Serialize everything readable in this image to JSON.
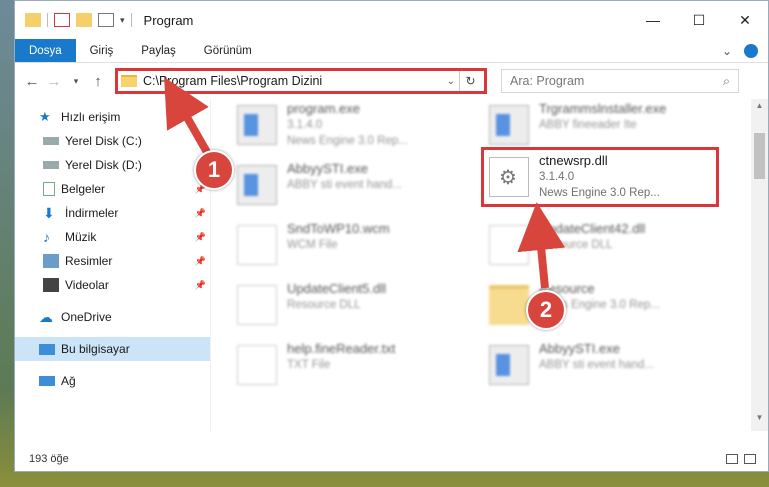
{
  "window": {
    "title": "Program",
    "controls": [
      "—",
      "☐",
      "✕"
    ]
  },
  "ribbon": {
    "tabs": [
      "Dosya",
      "Giriş",
      "Paylaş",
      "Görünüm"
    ]
  },
  "nav": {
    "address_path": "C:\\Program Files\\Program Dizini",
    "search_placeholder": "Ara: Program"
  },
  "sidebar": {
    "items": [
      {
        "label": "Hızlı erişim"
      },
      {
        "label": "Yerel Disk (C:)"
      },
      {
        "label": "Yerel Disk (D:)"
      },
      {
        "label": "Belgeler"
      },
      {
        "label": "İndirmeler"
      },
      {
        "label": "Müzik"
      },
      {
        "label": "Resimler"
      },
      {
        "label": "Videolar"
      },
      {
        "label": "OneDrive"
      },
      {
        "label": "Bu bilgisayar"
      },
      {
        "label": "Ağ"
      }
    ]
  },
  "files": [
    {
      "name": "program.exe",
      "line2": "3.1.4.0",
      "line3": "News Engine 3.0 Rep..."
    },
    {
      "name": "Trgrammslnstaller.exe",
      "line2": "ABBY fineeader Ite",
      "line3": ""
    },
    {
      "name": "AbbyySTI.exe",
      "line2": "ABBY sti event hand...",
      "line3": ""
    },
    {
      "name": "ctnewsrp.dll",
      "line2": "3.1.4.0",
      "line3": "News Engine 3.0 Rep..."
    },
    {
      "name": "SndToWP10.wcm",
      "line2": "WCM File",
      "line3": ""
    },
    {
      "name": "UpdateClient42.dll",
      "line2": "Resource DLL",
      "line3": ""
    },
    {
      "name": "UpdateClient5.dll",
      "line2": "Resource DLL",
      "line3": ""
    },
    {
      "name": "Resource",
      "line2": "News Engine 3.0 Rep...",
      "line3": ""
    },
    {
      "name": "help.fineReader.txt",
      "line2": "TXT File",
      "line3": ""
    },
    {
      "name": "AbbyySTI.exe",
      "line2": "ABBY sti event hand...",
      "line3": ""
    }
  ],
  "annotations": {
    "badge1": "1",
    "badge2": "2"
  },
  "status": {
    "count": "193 öğe"
  },
  "colors": {
    "accent": "#1979ca",
    "highlight": "#d9373a",
    "badge": "#d8453d"
  }
}
